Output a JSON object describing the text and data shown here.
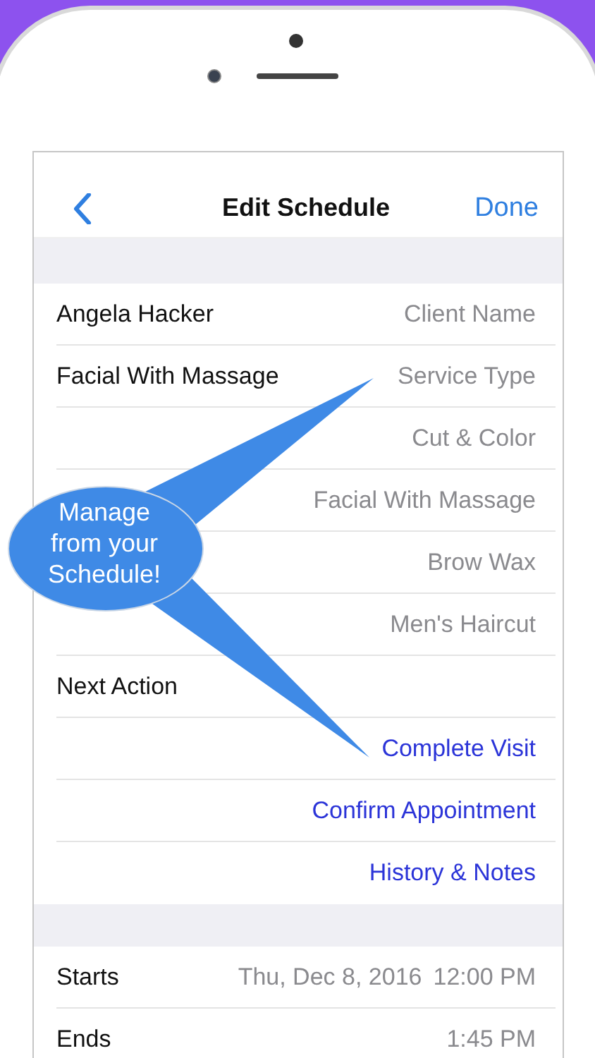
{
  "nav": {
    "title": "Edit Schedule",
    "done": "Done"
  },
  "rows": [
    {
      "kind": "field",
      "label": "Angela Hacker",
      "value": "Client Name"
    },
    {
      "kind": "field",
      "label": "Facial With Massage",
      "value": "Service Type"
    },
    {
      "kind": "option",
      "value": "Cut & Color"
    },
    {
      "kind": "option",
      "value": "Facial With Massage"
    },
    {
      "kind": "option",
      "value": "Brow Wax"
    },
    {
      "kind": "option",
      "value": "Men's Haircut"
    },
    {
      "kind": "header",
      "label": "Next Action"
    },
    {
      "kind": "action",
      "value": "Complete Visit"
    },
    {
      "kind": "action",
      "value": "Confirm Appointment"
    },
    {
      "kind": "action",
      "value": "History & Notes"
    }
  ],
  "time_rows": [
    {
      "label": "Starts",
      "date": "Thu, Dec 8, 2016",
      "time": "12:00 PM"
    },
    {
      "label": "Ends",
      "time": "1:45 PM"
    }
  ],
  "callout": {
    "text": "Manage from your Schedule!"
  }
}
